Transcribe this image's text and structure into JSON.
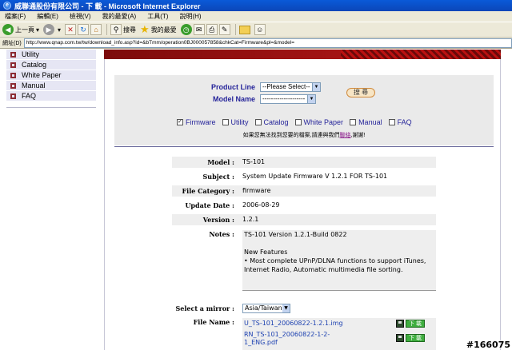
{
  "window": {
    "title": "威聯通股份有限公司 - 下 載 - Microsoft Internet Explorer"
  },
  "menu": [
    "檔案(F)",
    "編輯(E)",
    "檢視(V)",
    "我的最愛(A)",
    "工具(T)",
    "說明(H)"
  ],
  "toolbar": {
    "back_label": "上一頁",
    "search_label": "搜尋",
    "favorites_label": "我的最愛"
  },
  "address": {
    "label": "網址(D)",
    "url": "http://www.qnap.com.tw/tw/download_info.asp?id=&bTmm/operation0BJ000057858&chkCat=Firmware&pl=&model="
  },
  "sidebar": {
    "items": [
      "Utility",
      "Catalog",
      "White Paper",
      "Manual",
      "FAQ"
    ]
  },
  "search": {
    "product_line_label": "Product Line",
    "product_line_value": "--Please Select--",
    "model_name_label": "Model Name",
    "model_name_value": "--------------------",
    "search_button": "搜 尋",
    "categories": [
      {
        "label": "Firmware",
        "checked": true
      },
      {
        "label": "Utility",
        "checked": false
      },
      {
        "label": "Catalog",
        "checked": false
      },
      {
        "label": "White Paper",
        "checked": false
      },
      {
        "label": "Manual",
        "checked": false
      },
      {
        "label": "FAQ",
        "checked": false
      }
    ],
    "notice_before": "如果您無法找到您要的檔案,請連與我們",
    "notice_link": "聯絡",
    "notice_after": ",謝謝!"
  },
  "detail": {
    "model_label": "Model :",
    "model": "TS-101",
    "subject_label": "Subject :",
    "subject": "System Update Firmware V 1.2.1 FOR TS-101",
    "category_label": "File Category :",
    "category": "firmware",
    "date_label": "Update Date :",
    "date": "2006-08-29",
    "version_label": "Version :",
    "version": "1.2.1",
    "notes_label": "Notes :",
    "notes_line1": "TS-101 Version 1.2.1-Build 0822",
    "notes_line2": "New Features",
    "notes_line3": "• Most complete UPnP/DLNA functions to support iTunes,",
    "notes_line4": "Internet Radio, Automatic multimedia file sorting.",
    "mirror_label": "Select a mirror :",
    "mirror_value": "Asia/Taiwan",
    "file_label": "File Name :",
    "file1": "U_TS-101_20060822-1.2.1.img",
    "file2_line1": "RN_TS-101_20060822-1-2-",
    "file2_line2": "1_ENG.pdf",
    "download_label": "下 載"
  },
  "watermark": "#166075"
}
